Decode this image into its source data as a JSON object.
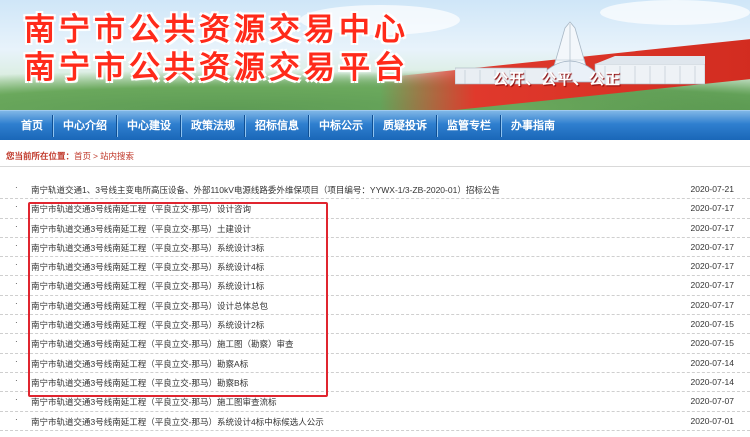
{
  "header": {
    "title_line1": "南宁市公共资源交易中心",
    "title_line2": "南宁市公共资源交易平台",
    "slogan": "公开、公平、公正"
  },
  "nav": {
    "items": [
      "首页",
      "中心介绍",
      "中心建设",
      "政策法规",
      "招标信息",
      "中标公示",
      "质疑投诉",
      "监管专栏",
      "办事指南"
    ]
  },
  "breadcrumb": {
    "label": "您当前所在位置：",
    "home": "首页",
    "separator": ">",
    "current": "站内搜索"
  },
  "list": {
    "bullet": "·",
    "items": [
      {
        "title": "南宁轨道交通1、3号线主变电所高压设备、外部110kV电源线路委外维保项目（项目编号：YYWX-1/3-ZB-2020-01）招标公告",
        "date": "2020-07-21"
      },
      {
        "title": "南宁市轨道交通3号线南延工程（平良立交-那马）设计咨询",
        "date": "2020-07-17"
      },
      {
        "title": "南宁市轨道交通3号线南延工程（平良立交-那马）土建设计",
        "date": "2020-07-17"
      },
      {
        "title": "南宁市轨道交通3号线南延工程（平良立交-那马）系统设计3标",
        "date": "2020-07-17"
      },
      {
        "title": "南宁市轨道交通3号线南延工程（平良立交-那马）系统设计4标",
        "date": "2020-07-17"
      },
      {
        "title": "南宁市轨道交通3号线南延工程（平良立交-那马）系统设计1标",
        "date": "2020-07-17"
      },
      {
        "title": "南宁市轨道交通3号线南延工程（平良立交-那马）设计总体总包",
        "date": "2020-07-17"
      },
      {
        "title": "南宁市轨道交通3号线南延工程（平良立交-那马）系统设计2标",
        "date": "2020-07-15"
      },
      {
        "title": "南宁市轨道交通3号线南延工程（平良立交-那马）施工图（勘察）审查",
        "date": "2020-07-15"
      },
      {
        "title": "南宁市轨道交通3号线南延工程（平良立交-那马）勘察A标",
        "date": "2020-07-14"
      },
      {
        "title": "南宁市轨道交通3号线南延工程（平良立交-那马）勘察B标",
        "date": "2020-07-14"
      },
      {
        "title": "南宁市轨道交通3号线南延工程（平良立交-那马）施工图审查流标",
        "date": "2020-07-07"
      },
      {
        "title": "南宁市轨道交通3号线南延工程（平良立交-那马）系统设计4标中标候选人公示",
        "date": "2020-07-01"
      }
    ]
  },
  "colors": {
    "title_red": "#ff2a1a",
    "nav_blue": "#1a67b8",
    "breadcrumb_red": "#c0392b",
    "highlight_red": "#e0252f"
  }
}
